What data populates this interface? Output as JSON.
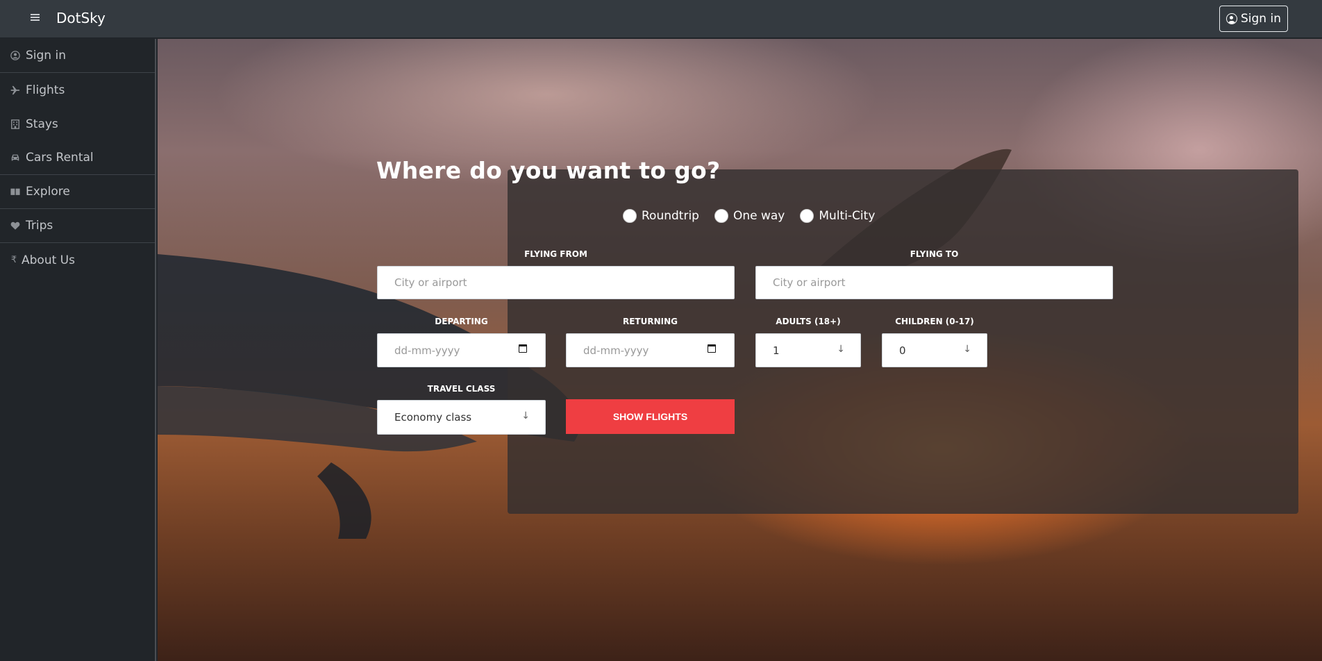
{
  "app": {
    "brand": "DotSky"
  },
  "topbar": {
    "signin_label": "Sign in"
  },
  "sidebar": {
    "items": [
      {
        "label": "Sign in",
        "icon": "user-circle-icon"
      },
      {
        "label": "Flights",
        "icon": "plane-icon"
      },
      {
        "label": "Stays",
        "icon": "building-icon"
      },
      {
        "label": "Cars Rental",
        "icon": "car-icon"
      },
      {
        "label": "Explore",
        "icon": "book-icon"
      },
      {
        "label": "Trips",
        "icon": "heart-icon"
      },
      {
        "label": "About Us",
        "icon": "rupee-icon"
      }
    ]
  },
  "search": {
    "title": "Where do you want to go?",
    "trip_types": [
      "Roundtrip",
      "One way",
      "Multi-City"
    ],
    "flying_from": {
      "label": "FLYING FROM",
      "placeholder": "City or airport"
    },
    "flying_to": {
      "label": "FLYING TO",
      "placeholder": "City or airport"
    },
    "departing": {
      "label": "DEPARTING",
      "placeholder": "dd-mm-yyyy"
    },
    "returning": {
      "label": "RETURNING",
      "placeholder": "dd-mm-yyyy"
    },
    "adults": {
      "label": "ADULTS (18+)",
      "value": "1"
    },
    "children": {
      "label": "CHILDREN (0-17)",
      "value": "0"
    },
    "travel_class": {
      "label": "TRAVEL CLASS",
      "value": "Economy class"
    },
    "submit_label": "SHOW FLIGHTS"
  },
  "colors": {
    "accent": "#ef3e42",
    "topbar": "#343a40",
    "sidebar": "#212529"
  }
}
